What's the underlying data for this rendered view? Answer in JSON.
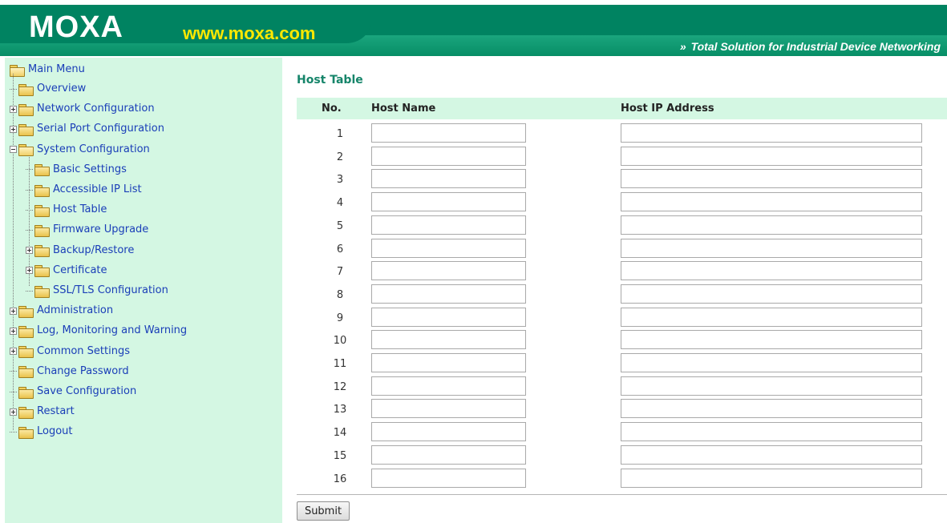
{
  "header": {
    "logo": "MOXA",
    "url": "www.moxa.com",
    "tagline_arrows": "»",
    "tagline": "Total Solution for Industrial Device Networking",
    "colors": {
      "brand_green": "#008361",
      "url_yellow": "#ffe800"
    }
  },
  "sidebar": {
    "background": "#d4f7e3",
    "root": {
      "label": "Main Menu",
      "icon": "folder-open-icon"
    },
    "items": [
      {
        "label": "Overview",
        "icon": "folder-icon",
        "expander": "none",
        "level": 1
      },
      {
        "label": "Network Configuration",
        "icon": "folder-icon",
        "expander": "plus",
        "level": 1
      },
      {
        "label": "Serial Port Configuration",
        "icon": "folder-icon",
        "expander": "plus",
        "level": 1
      },
      {
        "label": "System Configuration",
        "icon": "folder-open-icon",
        "expander": "minus",
        "level": 1
      },
      {
        "label": "Basic Settings",
        "icon": "folder-icon",
        "expander": "none",
        "level": 2
      },
      {
        "label": "Accessible IP List",
        "icon": "folder-icon",
        "expander": "none",
        "level": 2
      },
      {
        "label": "Host Table",
        "icon": "folder-icon",
        "expander": "none",
        "level": 2
      },
      {
        "label": "Firmware Upgrade",
        "icon": "folder-icon",
        "expander": "none",
        "level": 2
      },
      {
        "label": "Backup/Restore",
        "icon": "folder-icon",
        "expander": "plus",
        "level": 2
      },
      {
        "label": "Certificate",
        "icon": "folder-icon",
        "expander": "plus",
        "level": 2
      },
      {
        "label": "SSL/TLS Configuration",
        "icon": "folder-icon",
        "expander": "none",
        "level": 2
      },
      {
        "label": "Administration",
        "icon": "folder-icon",
        "expander": "plus",
        "level": 1
      },
      {
        "label": "Log, Monitoring and Warning",
        "icon": "folder-icon",
        "expander": "plus",
        "level": 1
      },
      {
        "label": "Common Settings",
        "icon": "folder-icon",
        "expander": "plus",
        "level": 1
      },
      {
        "label": "Change Password",
        "icon": "folder-icon",
        "expander": "none",
        "level": 1
      },
      {
        "label": "Save Configuration",
        "icon": "folder-icon",
        "expander": "none",
        "level": 1
      },
      {
        "label": "Restart",
        "icon": "folder-icon",
        "expander": "plus",
        "level": 1
      },
      {
        "label": "Logout",
        "icon": "folder-icon",
        "expander": "none",
        "level": 1
      }
    ]
  },
  "main": {
    "title": "Host Table",
    "columns": {
      "no": "No.",
      "host_name": "Host Name",
      "host_ip": "Host IP Address"
    },
    "rows": [
      {
        "no": "1",
        "host_name": "",
        "host_ip": ""
      },
      {
        "no": "2",
        "host_name": "",
        "host_ip": ""
      },
      {
        "no": "3",
        "host_name": "",
        "host_ip": ""
      },
      {
        "no": "4",
        "host_name": "",
        "host_ip": ""
      },
      {
        "no": "5",
        "host_name": "",
        "host_ip": ""
      },
      {
        "no": "6",
        "host_name": "",
        "host_ip": ""
      },
      {
        "no": "7",
        "host_name": "",
        "host_ip": ""
      },
      {
        "no": "8",
        "host_name": "",
        "host_ip": ""
      },
      {
        "no": "9",
        "host_name": "",
        "host_ip": ""
      },
      {
        "no": "10",
        "host_name": "",
        "host_ip": ""
      },
      {
        "no": "11",
        "host_name": "",
        "host_ip": ""
      },
      {
        "no": "12",
        "host_name": "",
        "host_ip": ""
      },
      {
        "no": "13",
        "host_name": "",
        "host_ip": ""
      },
      {
        "no": "14",
        "host_name": "",
        "host_ip": ""
      },
      {
        "no": "15",
        "host_name": "",
        "host_ip": ""
      },
      {
        "no": "16",
        "host_name": "",
        "host_ip": ""
      }
    ],
    "submit_label": "Submit"
  }
}
